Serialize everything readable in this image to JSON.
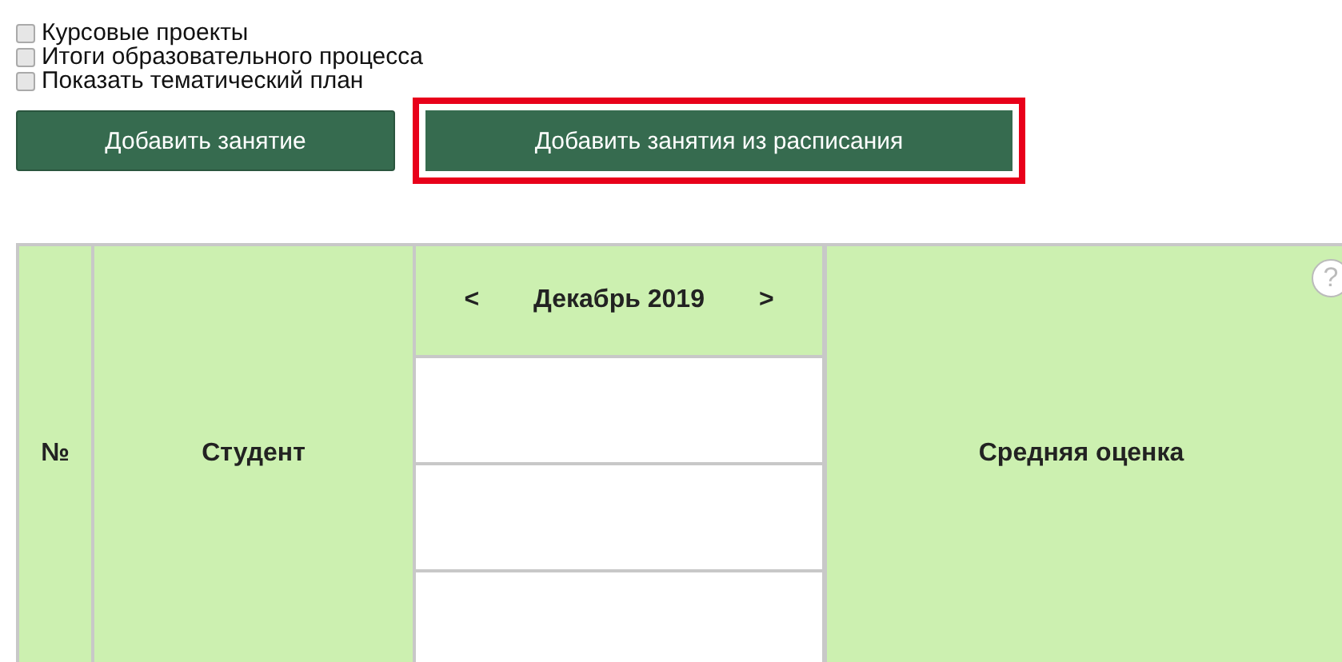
{
  "options": [
    {
      "label": "Курсовые проекты",
      "checked": false
    },
    {
      "label": "Итоги образовательного процесса",
      "checked": false
    },
    {
      "label": "Показать тематический план",
      "checked": false
    }
  ],
  "buttons": [
    {
      "label": "Добавить занятие",
      "highlighted": false
    },
    {
      "label": "Добавить занятия из расписания",
      "highlighted": true
    }
  ],
  "table": {
    "number_header": "№",
    "student_header": "Студент",
    "month": {
      "prev": "<",
      "label": "Декабрь 2019",
      "next": ">"
    },
    "average_header": "Средняя оценка",
    "help": "?"
  }
}
